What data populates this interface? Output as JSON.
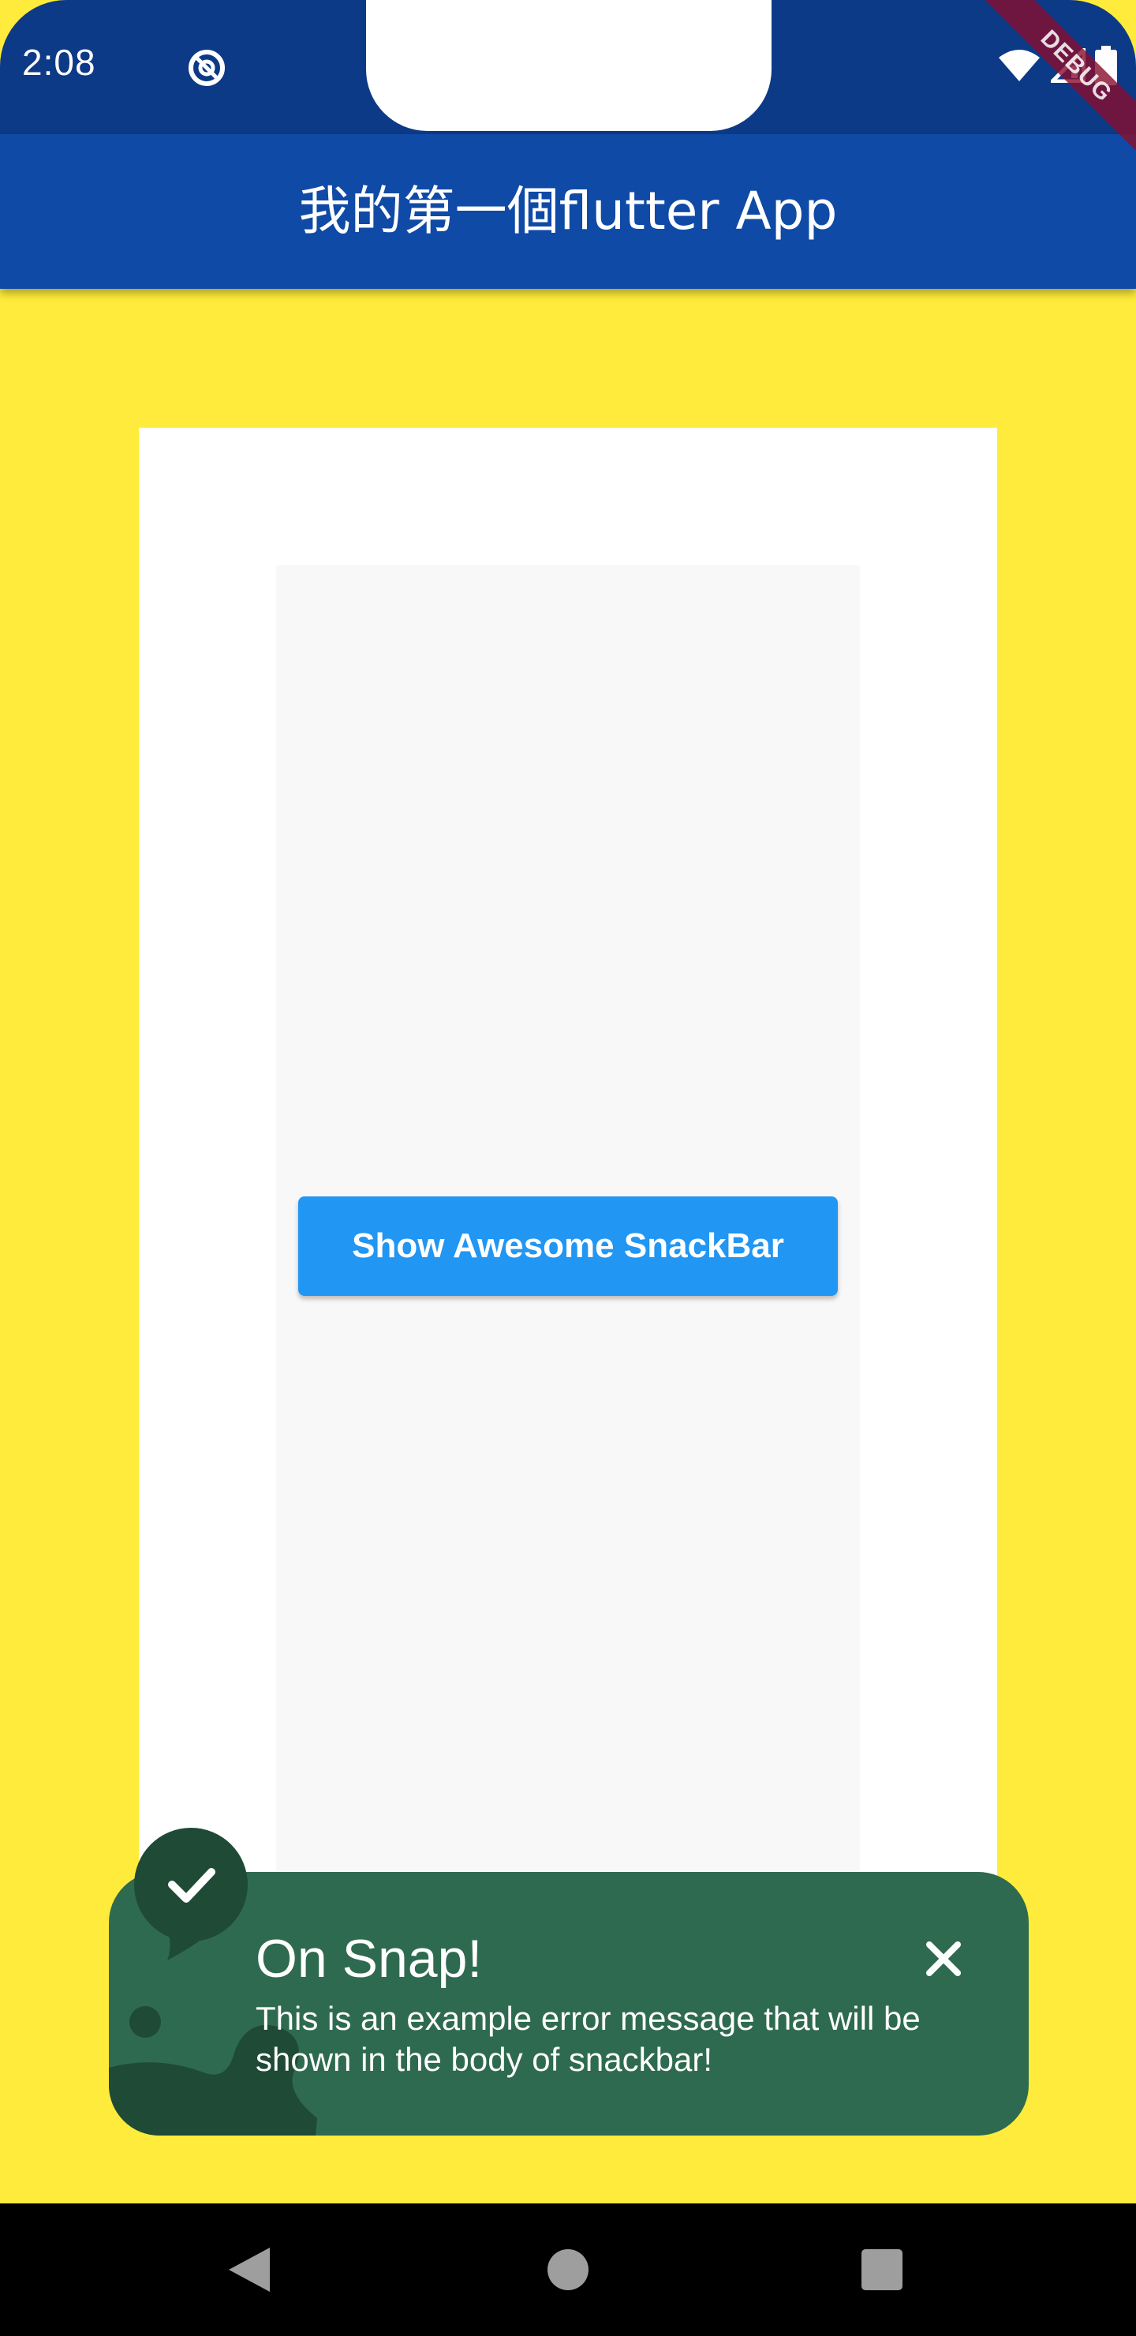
{
  "status_bar": {
    "time": "2:08",
    "icons": [
      "dnd-icon",
      "wifi-icon",
      "signal-icon",
      "battery-icon"
    ]
  },
  "debug_banner": "DEBUG",
  "app_bar": {
    "title": "我的第一個flutter App"
  },
  "body": {
    "button_label": "Show Awesome SnackBar"
  },
  "snackbar": {
    "title": "On Snap!",
    "message": "This is an example error message that will be shown in the body of snackbar!",
    "icon": "check-icon",
    "close_icon": "close-icon"
  },
  "nav_bar": {
    "items": [
      "back-icon",
      "home-icon",
      "recents-icon"
    ]
  },
  "colors": {
    "status_bar": "#0d3a86",
    "app_bar": "#0f4aa6",
    "background": "#ffeb3b",
    "button": "#2196f3",
    "snackbar": "#2e6a4f",
    "snackbar_dark": "#1e4a36"
  }
}
